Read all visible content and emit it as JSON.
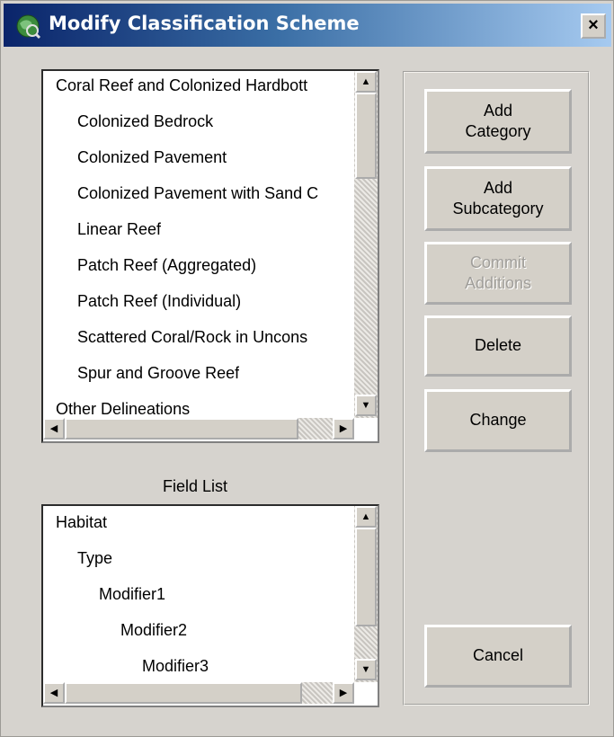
{
  "window": {
    "title": "Modify Classification Scheme",
    "close_glyph": "×",
    "icon": "globe-icon"
  },
  "category_list": {
    "items": [
      {
        "label": "Coral Reef and Colonized Hardbott",
        "level": 0
      },
      {
        "label": "Colonized Bedrock",
        "level": 1
      },
      {
        "label": "Colonized Pavement",
        "level": 1
      },
      {
        "label": "Colonized Pavement with Sand C",
        "level": 1
      },
      {
        "label": "Linear Reef",
        "level": 1
      },
      {
        "label": "Patch Reef (Aggregated)",
        "level": 1
      },
      {
        "label": "Patch Reef (Individual)",
        "level": 1
      },
      {
        "label": "Scattered Coral/Rock in Uncons",
        "level": 1
      },
      {
        "label": "Spur and Groove Reef",
        "level": 1
      },
      {
        "label": "Other Delineations",
        "level": 0
      }
    ]
  },
  "field_list": {
    "label": "Field List",
    "items": [
      "Habitat",
      "Type",
      "Modifier1",
      "Modifier2",
      "Modifier3"
    ]
  },
  "buttons": {
    "add_category": "Add\nCategory",
    "add_subcategory": "Add\nSubcategory",
    "commit_additions": "Commit\nAdditions",
    "delete": "Delete",
    "change": "Change",
    "cancel": "Cancel"
  },
  "scroll_glyphs": {
    "up": "▲",
    "down": "▼",
    "left": "◀",
    "right": "▶"
  }
}
